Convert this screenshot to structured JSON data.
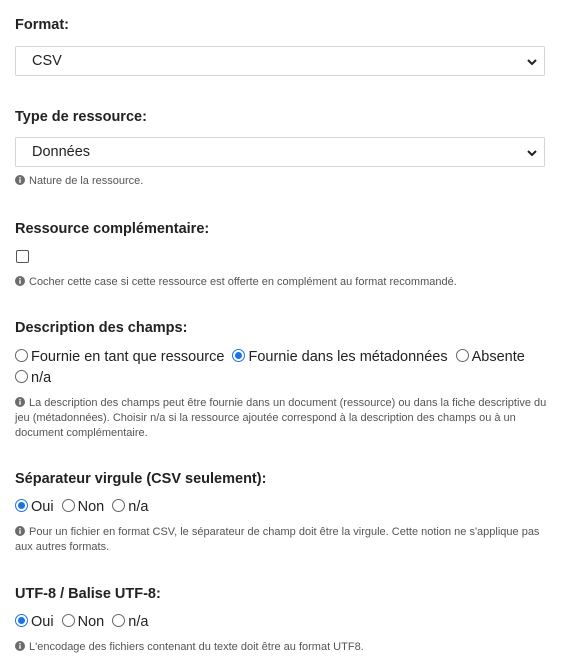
{
  "format": {
    "label": "Format:",
    "selected": "CSV"
  },
  "type_ressource": {
    "label": "Type de ressource:",
    "selected": "Données",
    "help": "Nature de la ressource."
  },
  "ressource_complementaire": {
    "label": "Ressource complémentaire:",
    "checked": false,
    "help": "Cocher cette case si cette ressource est offerte en complément au format recommandé."
  },
  "description_champs": {
    "label": "Description des champs:",
    "options": [
      "Fournie en tant que ressource",
      "Fournie dans les métadonnées",
      "Absente",
      "n/a"
    ],
    "selected": "Fournie dans les métadonnées",
    "help_lines": [
      "La description des champs peut être fournie dans un document (ressource) ou dans la fiche descriptive du",
      "jeu (métadonnées). Choisir n/a si la ressource ajoutée correspond à la description des champs ou à un",
      "document complémentaire."
    ]
  },
  "separateur_virgule": {
    "label": "Séparateur virgule (CSV seulement):",
    "options": [
      "Oui",
      "Non",
      "n/a"
    ],
    "selected": "Oui",
    "help_lines": [
      "Pour un fichier en format CSV, le séparateur de champ doit être la virgule. Cette notion ne s'applique pas",
      "aux autres formats."
    ]
  },
  "utf8": {
    "label": "UTF-8 / Balise UTF-8:",
    "options": [
      "Oui",
      "Non",
      "n/a"
    ],
    "selected": "Oui",
    "help": "L'encodage des fichiers contenant du texte doit être au format UTF8."
  },
  "icons": {
    "info": "info-circle-icon",
    "chevron": "chevron-down-icon"
  },
  "colors": {
    "accent": "#1a73e8",
    "help_text": "#555555",
    "border": "#d5d5d5"
  }
}
